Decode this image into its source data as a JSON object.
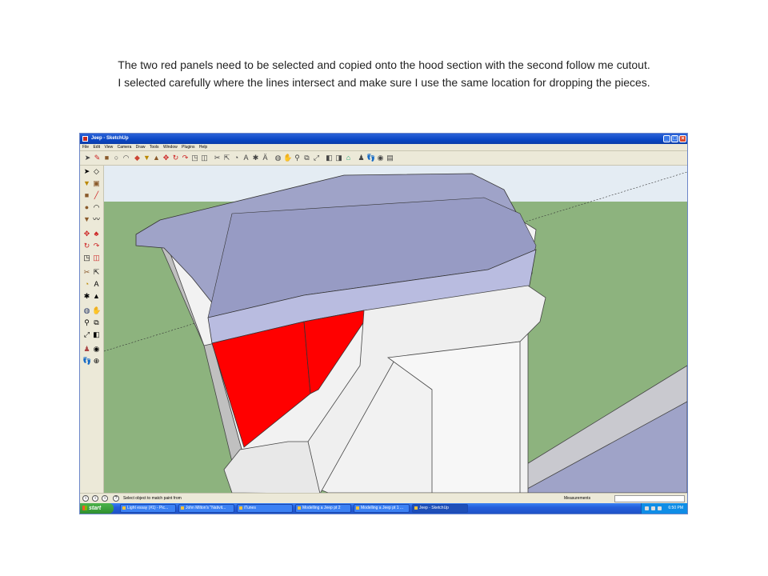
{
  "caption": {
    "line1": "The two red panels need to be selected and copied onto the hood section with the second follow me cutout.",
    "line2": "I selected carefully where the lines intersect and make sure I use the same location for dropping the pieces."
  },
  "window": {
    "title": "Jeep - SketchUp",
    "menu": [
      "File",
      "Edit",
      "View",
      "Camera",
      "Draw",
      "Tools",
      "Window",
      "Plugins",
      "Help"
    ]
  },
  "colors": {
    "ground": "#8db37e",
    "sky": "#e4ecf3",
    "panel_red": "#ff0000",
    "hood_blue": "#9fa3c8",
    "face_white": "#f2f2f2"
  },
  "statusbar": {
    "hint": "Select object to match paint from",
    "measurements_label": "Measurements"
  },
  "taskbar": {
    "start": "start",
    "items": [
      "Light essay (#1) - Pic...",
      "John Milton's \"Nativit...",
      "iTunes",
      "Modelling a Jeep pt 2",
      "Modelling a Jeep pt 1 ...",
      "Jeep - SketchUp"
    ],
    "clock": "6:50 PM"
  }
}
